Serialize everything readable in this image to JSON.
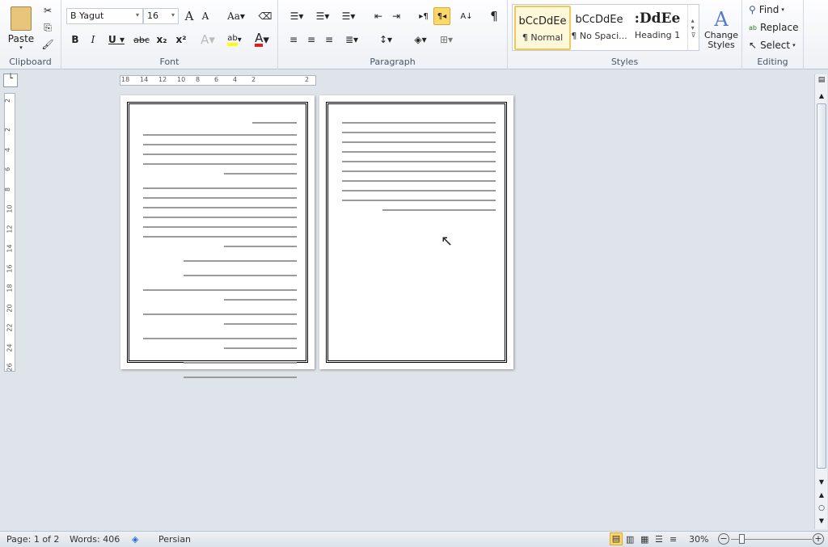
{
  "ribbon": {
    "clipboard": {
      "label": "Clipboard",
      "paste": "Paste"
    },
    "font": {
      "label": "Font",
      "font_name": "B Yagut",
      "font_size": "16"
    },
    "paragraph": {
      "label": "Paragraph"
    },
    "styles": {
      "label": "Styles",
      "items": [
        {
          "preview": "bCcDdEe",
          "name": "¶ Normal",
          "selected": true
        },
        {
          "preview": "bCcDdEe",
          "name": "¶ No Spaci..."
        },
        {
          "preview": ":DdEe",
          "name": "Heading 1"
        }
      ],
      "change_styles": "Change Styles"
    },
    "editing": {
      "label": "Editing",
      "find": "Find",
      "replace": "Replace",
      "select": "Select"
    }
  },
  "ruler": {
    "ticks": [
      "18",
      "14",
      "12",
      "10",
      "8",
      "6",
      "4",
      "2",
      "2"
    ]
  },
  "vruler": {
    "ticks": [
      "2",
      "2",
      "4",
      "6",
      "8",
      "10",
      "12",
      "14",
      "16",
      "18",
      "20",
      "22",
      "24",
      "26"
    ]
  },
  "status": {
    "page": "Page: 1 of 2",
    "words": "Words: 406",
    "language": "Persian",
    "zoom": "30%",
    "zoom_level_percent": 30
  },
  "colors": {
    "highlight": "#ffff00",
    "font_color": "#e02020",
    "accent": "#fcd76a"
  }
}
